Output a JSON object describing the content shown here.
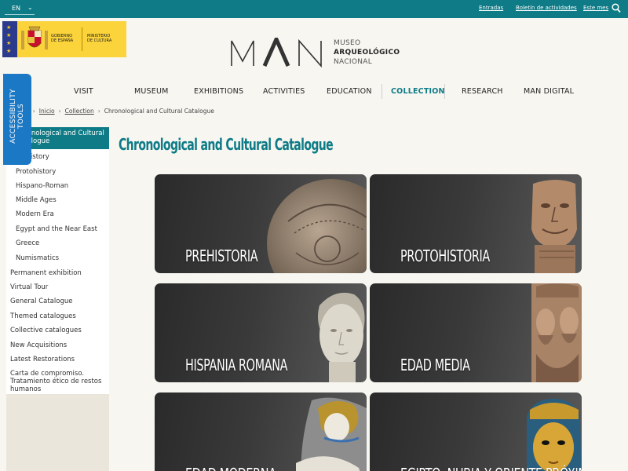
{
  "topbar": {
    "lang_code": "EN",
    "links": [
      "Entradas",
      "Boletín de actividades",
      "Este mes"
    ]
  },
  "header": {
    "gov_logo": {
      "line1": "GOBIERNO\nDE ESPAÑA",
      "line2": "MINISTERIO\nDE CULTURA"
    },
    "museum_logo": "MAN",
    "museum_name": [
      "MUSEO",
      "ARQUEOLÓGICO",
      "NACIONAL"
    ]
  },
  "nav": {
    "items": [
      "VISIT",
      "MUSEUM",
      "EXHIBITIONS",
      "ACTIVITIES",
      "EDUCATION",
      "COLLECTION",
      "RESEARCH",
      "MAN DIGITAL"
    ],
    "active": "COLLECTION"
  },
  "accessibility": {
    "line1": "ACCESSIBILITY",
    "line2": "TOOLS"
  },
  "breadcrumb": {
    "items": [
      "Inicio",
      "Collection",
      "Chronological and Cultural Catalogue"
    ]
  },
  "sidebar": {
    "heading": "Chronological and Cultural Catalogue",
    "subitems": [
      "Prehistory",
      "Protohistory",
      "Hispano-Roman",
      "Middle Ages",
      "Modern Era",
      "Egypt and the Near East",
      "Greece",
      "Numismatics"
    ],
    "items": [
      "Permanent exhibition",
      "Virtual Tour",
      "General Catalogue",
      "Themed catalogues",
      "Collective catalogues",
      "New Acquisitions",
      "Latest Restorations",
      "Carta de compromiso. Tratamiento ético de restos humanos"
    ]
  },
  "main": {
    "title": "Chronological and Cultural Catalogue",
    "cards": [
      {
        "label": "PREHISTORIA",
        "art": "carved-stone-ball-image"
      },
      {
        "label": "PROTOHISTORIA",
        "art": "stone-head-image"
      },
      {
        "label": "HISPANIA ROMANA",
        "art": "roman-bust-image"
      },
      {
        "label": "EDAD MEDIA",
        "art": "romanesque-capital-image"
      },
      {
        "label": "EDAD MODERNA",
        "art": "baroque-sculpture-image"
      },
      {
        "label": "EGIPTO, NUBIA Y ORIENTE PRÓXIMO",
        "art": "egyptian-mask-image"
      }
    ]
  },
  "colors": {
    "teal": "#0e7b86",
    "a11y_blue": "#1b78c5",
    "gov_yellow": "#fbd33a"
  }
}
